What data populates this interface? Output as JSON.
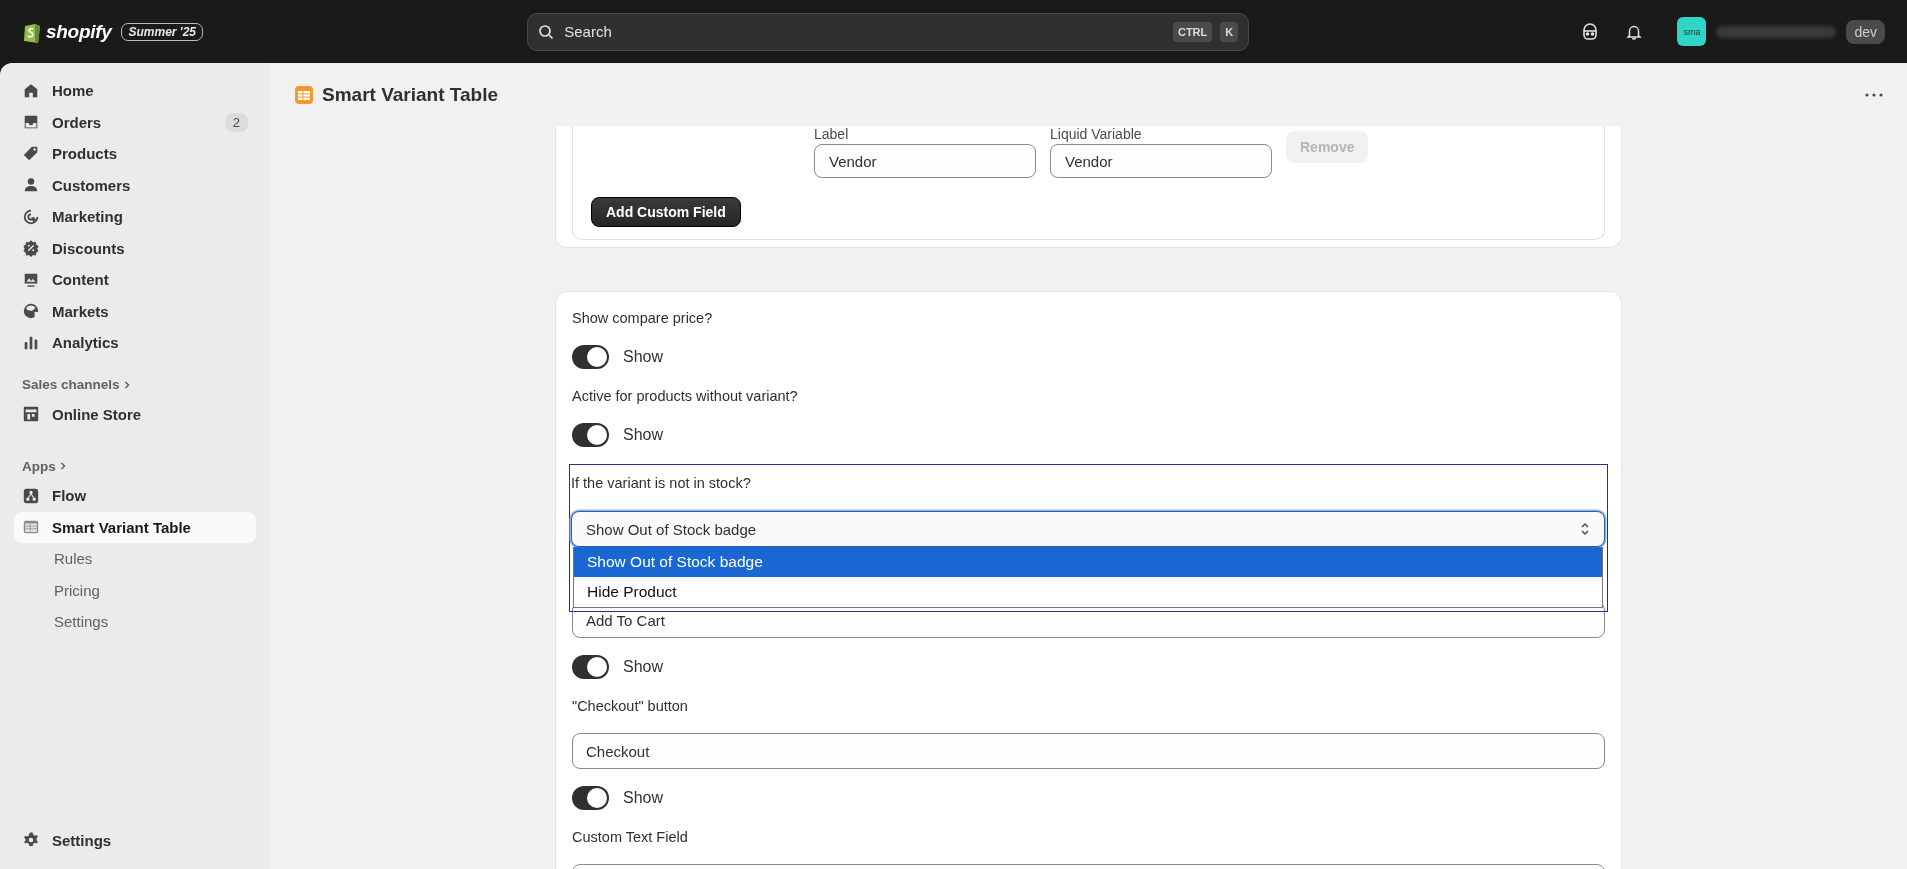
{
  "topbar": {
    "logo": "shopify",
    "edition_badge": "Summer '25",
    "search": {
      "placeholder": "Search",
      "shortcut_keys": [
        "CTRL",
        "K"
      ]
    },
    "avatar_initials": "sma",
    "store_badge": "dev"
  },
  "sidebar": {
    "nav": [
      {
        "label": "Home",
        "selected": false
      },
      {
        "label": "Orders",
        "selected": false,
        "badge": "2"
      },
      {
        "label": "Products",
        "selected": false
      },
      {
        "label": "Customers",
        "selected": false
      },
      {
        "label": "Marketing",
        "selected": false
      },
      {
        "label": "Discounts",
        "selected": false
      },
      {
        "label": "Content",
        "selected": false
      },
      {
        "label": "Markets",
        "selected": false
      },
      {
        "label": "Analytics",
        "selected": false
      }
    ],
    "sections": [
      {
        "title": "Sales channels",
        "items": [
          {
            "label": "Online Store",
            "selected": false
          }
        ]
      },
      {
        "title": "Apps",
        "items": [
          {
            "label": "Flow",
            "selected": false
          },
          {
            "label": "Smart Variant Table",
            "selected": true,
            "children": [
              {
                "label": "Rules",
                "selected": false
              },
              {
                "label": "Pricing",
                "selected": false
              },
              {
                "label": "Settings",
                "selected": false
              }
            ]
          }
        ]
      }
    ],
    "footer": {
      "label": "Settings"
    }
  },
  "page": {
    "title": "Smart Variant Table",
    "custom_fields": {
      "columns": [
        "Label",
        "Liquid Variable"
      ],
      "row": {
        "label": "Vendor",
        "variable": "Vendor",
        "remove": "Remove",
        "remove_disabled": true
      },
      "add_button": "Add Custom Field"
    },
    "settings": [
      {
        "kind": "label",
        "text": "Show compare price?"
      },
      {
        "kind": "toggle",
        "on": true,
        "text": "Show"
      },
      {
        "kind": "label",
        "text": "Active for products without variant?"
      },
      {
        "kind": "toggle",
        "on": true,
        "text": "Show"
      },
      {
        "kind": "select",
        "label": "If the variant is not in stock?",
        "value": "Show Out of Stock badge",
        "focused": true,
        "expanded": true,
        "options": [
          {
            "label": "Show Out of Stock badge",
            "selected": true
          },
          {
            "label": "Hide Product",
            "selected": false
          }
        ]
      },
      {
        "kind": "field",
        "value": "Add To Cart"
      },
      {
        "kind": "toggle",
        "on": true,
        "text": "Show"
      },
      {
        "kind": "label",
        "text": "\"Checkout\" button"
      },
      {
        "kind": "field",
        "value": "Checkout"
      },
      {
        "kind": "toggle",
        "on": true,
        "text": "Show"
      },
      {
        "kind": "label",
        "text": "Custom Text Field"
      },
      {
        "kind": "field"
      }
    ]
  }
}
